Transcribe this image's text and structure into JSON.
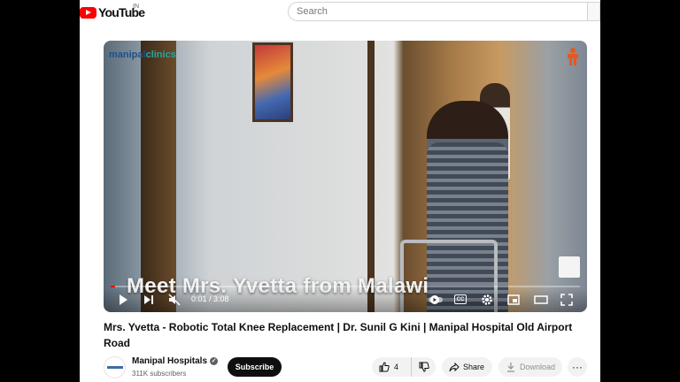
{
  "header": {
    "logo_text": "YouTube",
    "region": "IN",
    "search_placeholder": "Search"
  },
  "player": {
    "watermark_prefix": "manipal",
    "watermark_suffix": "clinics",
    "caption": "Meet Mrs. Yvetta from Malawi",
    "time": "0:01 / 3:08",
    "progress": 0.01,
    "icons": [
      "play-icon",
      "next-icon",
      "mute-icon",
      "autoplay-icon",
      "captions-icon",
      "settings-icon",
      "miniplayer-icon",
      "theater-icon",
      "fullscreen-icon"
    ],
    "cc_label": "CC"
  },
  "video": {
    "title": "Mrs. Yvetta - Robotic Total Knee Replacement | Dr. Sunil G Kini | Manipal Hospital Old Airport Road"
  },
  "channel": {
    "name": "Manipal Hospitals",
    "subscribers": "311K subscribers",
    "subscribe_label": "Subscribe"
  },
  "actions": {
    "likes": "4",
    "share_label": "Share",
    "download_label": "Download",
    "more_label": "···"
  },
  "colors": {
    "brand_red": "#ff0000",
    "subscribe_bg": "#0f0f0f",
    "pill_bg": "#f2f2f2"
  }
}
